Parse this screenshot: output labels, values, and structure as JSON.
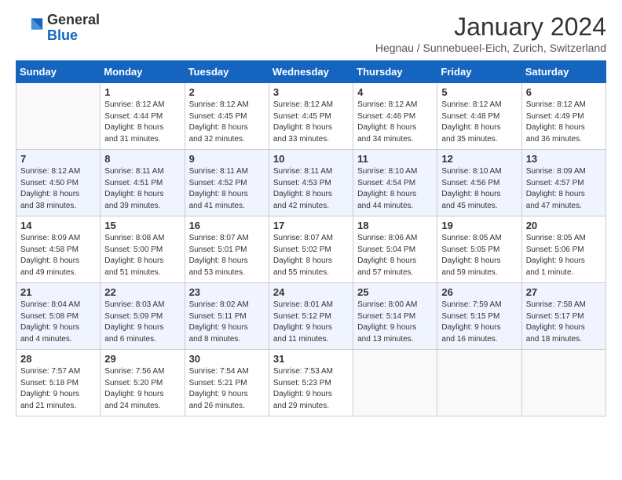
{
  "header": {
    "logo_general": "General",
    "logo_blue": "Blue",
    "month_title": "January 2024",
    "subtitle": "Hegnau / Sunnebueel-Eich, Zurich, Switzerland"
  },
  "days_of_week": [
    "Sunday",
    "Monday",
    "Tuesday",
    "Wednesday",
    "Thursday",
    "Friday",
    "Saturday"
  ],
  "weeks": [
    [
      {
        "day": "",
        "info": ""
      },
      {
        "day": "1",
        "info": "Sunrise: 8:12 AM\nSunset: 4:44 PM\nDaylight: 8 hours\nand 31 minutes."
      },
      {
        "day": "2",
        "info": "Sunrise: 8:12 AM\nSunset: 4:45 PM\nDaylight: 8 hours\nand 32 minutes."
      },
      {
        "day": "3",
        "info": "Sunrise: 8:12 AM\nSunset: 4:45 PM\nDaylight: 8 hours\nand 33 minutes."
      },
      {
        "day": "4",
        "info": "Sunrise: 8:12 AM\nSunset: 4:46 PM\nDaylight: 8 hours\nand 34 minutes."
      },
      {
        "day": "5",
        "info": "Sunrise: 8:12 AM\nSunset: 4:48 PM\nDaylight: 8 hours\nand 35 minutes."
      },
      {
        "day": "6",
        "info": "Sunrise: 8:12 AM\nSunset: 4:49 PM\nDaylight: 8 hours\nand 36 minutes."
      }
    ],
    [
      {
        "day": "7",
        "info": "Sunrise: 8:12 AM\nSunset: 4:50 PM\nDaylight: 8 hours\nand 38 minutes."
      },
      {
        "day": "8",
        "info": "Sunrise: 8:11 AM\nSunset: 4:51 PM\nDaylight: 8 hours\nand 39 minutes."
      },
      {
        "day": "9",
        "info": "Sunrise: 8:11 AM\nSunset: 4:52 PM\nDaylight: 8 hours\nand 41 minutes."
      },
      {
        "day": "10",
        "info": "Sunrise: 8:11 AM\nSunset: 4:53 PM\nDaylight: 8 hours\nand 42 minutes."
      },
      {
        "day": "11",
        "info": "Sunrise: 8:10 AM\nSunset: 4:54 PM\nDaylight: 8 hours\nand 44 minutes."
      },
      {
        "day": "12",
        "info": "Sunrise: 8:10 AM\nSunset: 4:56 PM\nDaylight: 8 hours\nand 45 minutes."
      },
      {
        "day": "13",
        "info": "Sunrise: 8:09 AM\nSunset: 4:57 PM\nDaylight: 8 hours\nand 47 minutes."
      }
    ],
    [
      {
        "day": "14",
        "info": "Sunrise: 8:09 AM\nSunset: 4:58 PM\nDaylight: 8 hours\nand 49 minutes."
      },
      {
        "day": "15",
        "info": "Sunrise: 8:08 AM\nSunset: 5:00 PM\nDaylight: 8 hours\nand 51 minutes."
      },
      {
        "day": "16",
        "info": "Sunrise: 8:07 AM\nSunset: 5:01 PM\nDaylight: 8 hours\nand 53 minutes."
      },
      {
        "day": "17",
        "info": "Sunrise: 8:07 AM\nSunset: 5:02 PM\nDaylight: 8 hours\nand 55 minutes."
      },
      {
        "day": "18",
        "info": "Sunrise: 8:06 AM\nSunset: 5:04 PM\nDaylight: 8 hours\nand 57 minutes."
      },
      {
        "day": "19",
        "info": "Sunrise: 8:05 AM\nSunset: 5:05 PM\nDaylight: 8 hours\nand 59 minutes."
      },
      {
        "day": "20",
        "info": "Sunrise: 8:05 AM\nSunset: 5:06 PM\nDaylight: 9 hours\nand 1 minute."
      }
    ],
    [
      {
        "day": "21",
        "info": "Sunrise: 8:04 AM\nSunset: 5:08 PM\nDaylight: 9 hours\nand 4 minutes."
      },
      {
        "day": "22",
        "info": "Sunrise: 8:03 AM\nSunset: 5:09 PM\nDaylight: 9 hours\nand 6 minutes."
      },
      {
        "day": "23",
        "info": "Sunrise: 8:02 AM\nSunset: 5:11 PM\nDaylight: 9 hours\nand 8 minutes."
      },
      {
        "day": "24",
        "info": "Sunrise: 8:01 AM\nSunset: 5:12 PM\nDaylight: 9 hours\nand 11 minutes."
      },
      {
        "day": "25",
        "info": "Sunrise: 8:00 AM\nSunset: 5:14 PM\nDaylight: 9 hours\nand 13 minutes."
      },
      {
        "day": "26",
        "info": "Sunrise: 7:59 AM\nSunset: 5:15 PM\nDaylight: 9 hours\nand 16 minutes."
      },
      {
        "day": "27",
        "info": "Sunrise: 7:58 AM\nSunset: 5:17 PM\nDaylight: 9 hours\nand 18 minutes."
      }
    ],
    [
      {
        "day": "28",
        "info": "Sunrise: 7:57 AM\nSunset: 5:18 PM\nDaylight: 9 hours\nand 21 minutes."
      },
      {
        "day": "29",
        "info": "Sunrise: 7:56 AM\nSunset: 5:20 PM\nDaylight: 9 hours\nand 24 minutes."
      },
      {
        "day": "30",
        "info": "Sunrise: 7:54 AM\nSunset: 5:21 PM\nDaylight: 9 hours\nand 26 minutes."
      },
      {
        "day": "31",
        "info": "Sunrise: 7:53 AM\nSunset: 5:23 PM\nDaylight: 9 hours\nand 29 minutes."
      },
      {
        "day": "",
        "info": ""
      },
      {
        "day": "",
        "info": ""
      },
      {
        "day": "",
        "info": ""
      }
    ]
  ]
}
